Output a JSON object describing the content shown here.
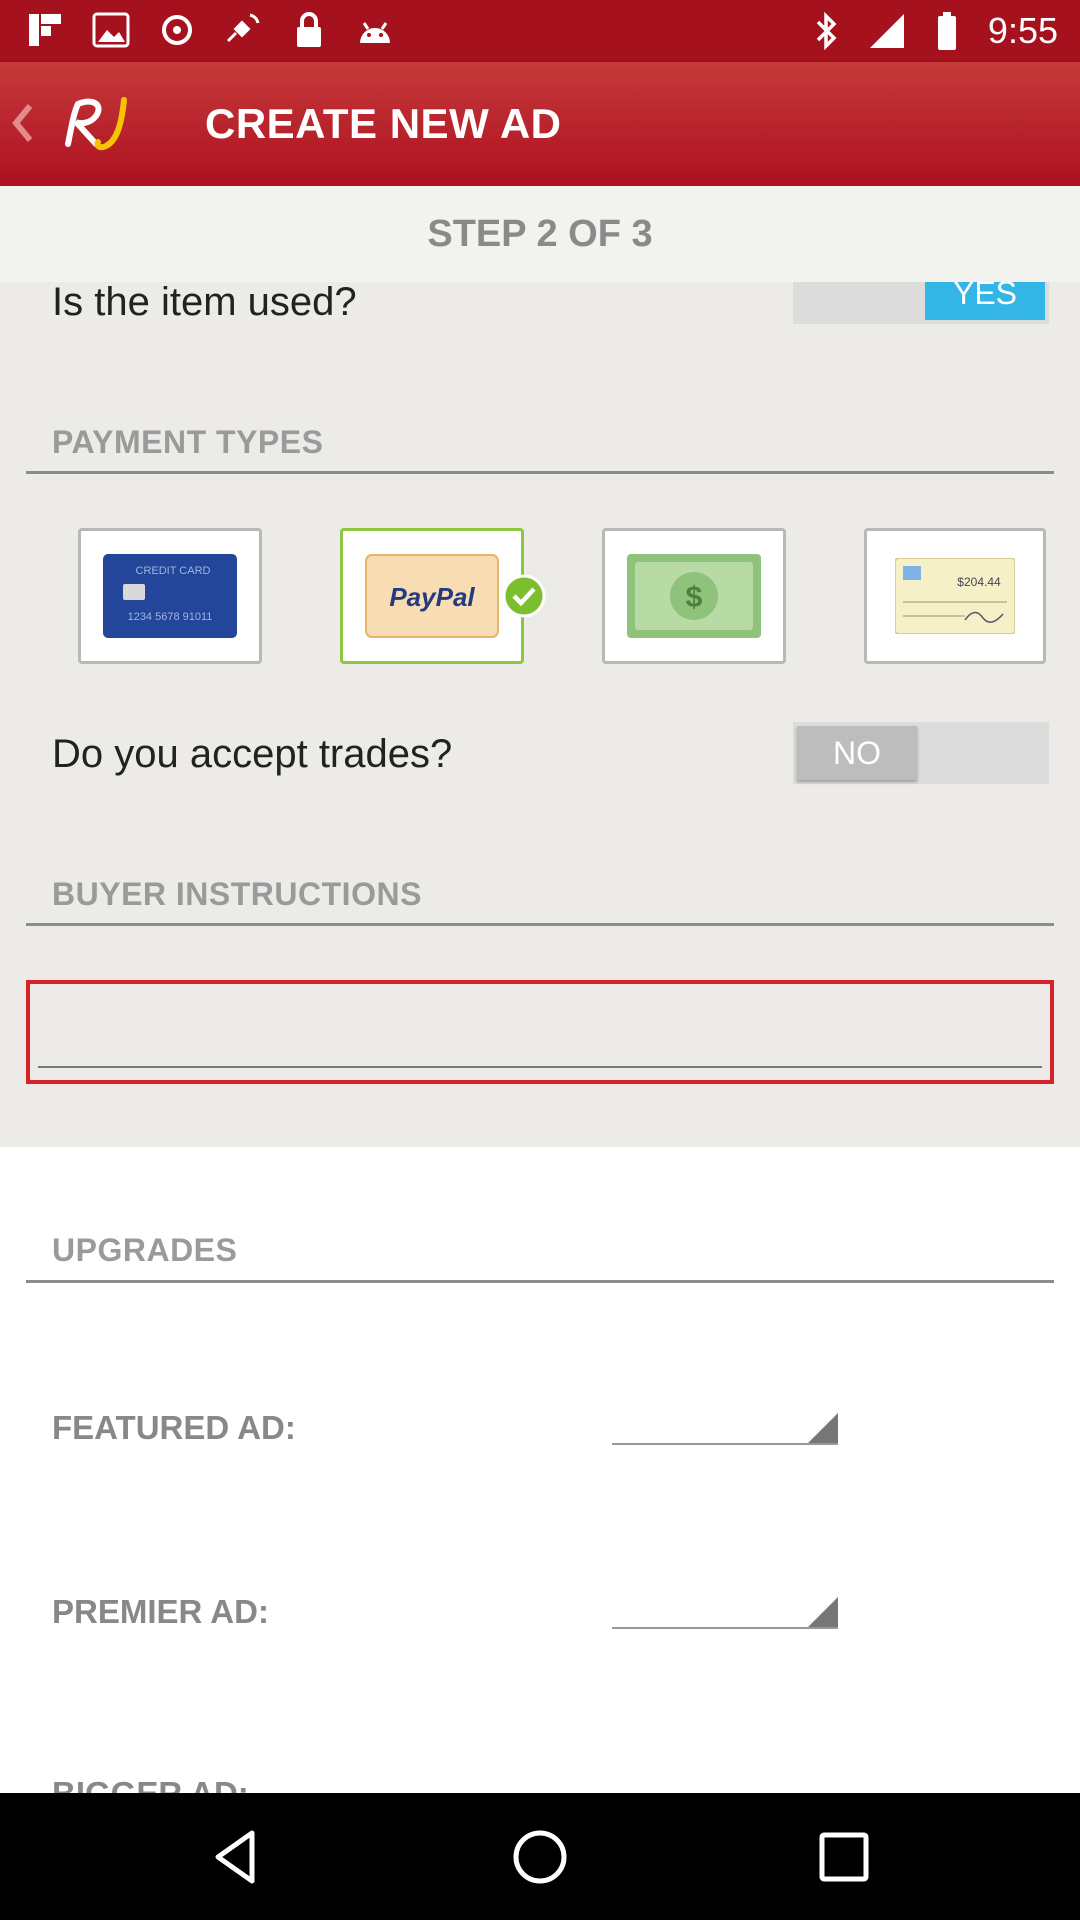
{
  "status_bar": {
    "time": "9:55",
    "icons": [
      "flipboard-icon",
      "image-icon",
      "sync-icon",
      "satellite-icon",
      "lock-icon",
      "android-icon",
      "bluetooth-icon",
      "signal-icon",
      "battery-icon"
    ]
  },
  "app_bar": {
    "title": "CREATE NEW AD",
    "logo_text": "RJ"
  },
  "step": {
    "text": "STEP 2 OF 3"
  },
  "item_used": {
    "label": "Is the item used?",
    "toggle_value": "YES"
  },
  "payment": {
    "heading": "PAYMENT TYPES",
    "types": [
      {
        "name": "credit-card",
        "label_top": "CREDIT CARD",
        "number": "1234 5678 91011",
        "selected": false
      },
      {
        "name": "paypal",
        "label": "PayPal",
        "selected": true
      },
      {
        "name": "cash",
        "symbol": "$",
        "selected": false
      },
      {
        "name": "check",
        "amount": "$204.44",
        "selected": false
      }
    ]
  },
  "trades": {
    "label": "Do you accept trades?",
    "toggle_value": "NO"
  },
  "buyer_instructions": {
    "heading": "BUYER INSTRUCTIONS",
    "value": ""
  },
  "upgrades": {
    "heading": "UPGRADES",
    "featured_label": "FEATURED AD:",
    "premier_label": "PREMIER AD:",
    "bigger_label": "BIGGER AD:"
  },
  "colors": {
    "brand_red": "#ad1020",
    "toggle_on": "#33b5e5",
    "selected_border": "#8dc63f",
    "error_border": "#d8232a"
  }
}
